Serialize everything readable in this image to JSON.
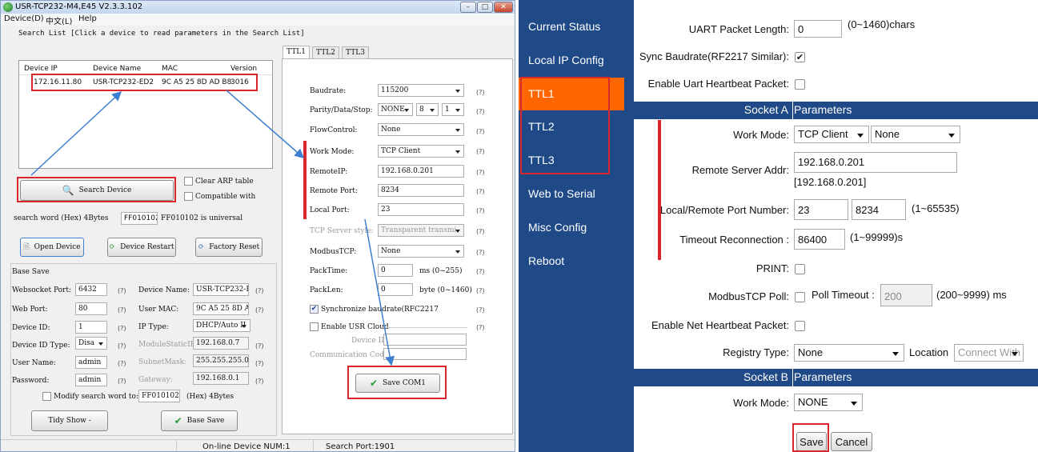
{
  "app": {
    "title": "USR-TCP232-M4,E45 V2.3.3.102",
    "menu": [
      "Device(D)",
      "中文(L)",
      "Help"
    ]
  },
  "search": {
    "hint": "Search List [Click a device to read parameters in the Search List]",
    "columns": [
      "Device IP",
      "Device Name",
      "MAC",
      "Version"
    ],
    "rows": [
      {
        "ip": "172.16.11.80",
        "name": "USR-TCP232-ED2",
        "mac": "9C A5 25 8D AD B8",
        "version": "3016"
      }
    ],
    "search_button": "Search Device",
    "clear_arp": "Clear ARP table",
    "compatible": "Compatible with",
    "word_label": "search word (Hex) 4Bytes",
    "word_value": "FF010102",
    "word_note": "FF010102 is universal"
  },
  "actions": {
    "open": "Open Device",
    "restart": "Device Restart",
    "reset": "Factory Reset"
  },
  "base": {
    "title": "Base Save",
    "websocket_label": "Websocket Port:",
    "websocket_value": "6432",
    "web_label": "Web Port:",
    "web_value": "80",
    "devid_label": "Device ID:",
    "devid_value": "1",
    "devidtype_label": "Device ID Type:",
    "devidtype_value": "Disa",
    "user_label": "User Name:",
    "user_value": "admin",
    "pass_label": "Password:",
    "pass_value": "admin",
    "devname_label": "Device Name:",
    "devname_value": "USR-TCP232-ED2",
    "mac_label": "User MAC:",
    "mac_value": "9C A5 25 8D AD",
    "ip_label": "IP    Type:",
    "ip_value": "DHCP/Auto II",
    "static_label": "ModuleStaticIP",
    "static_value": "192.168.0.7",
    "mask_label": "SubnetMask:",
    "mask_value": "255.255.255.0",
    "gw_label": "Gateway:",
    "gw_value": "192.168.0.1",
    "q": "(?)",
    "modify_label": "Modify search word to:",
    "modify_value": "FF010102",
    "modify_note": "(Hex) 4Bytes",
    "tidy": "Tidy Show  -",
    "save": "Base Save"
  },
  "ttl": {
    "tabs": [
      "TTL1",
      "TTL2",
      "TTL3"
    ],
    "rows": [
      {
        "label": "Baudrate:",
        "value": "115200"
      },
      {
        "label": "Parity/Data/Stop:",
        "v1": "NONE",
        "v2": "8",
        "v3": "1"
      },
      {
        "label": "FlowControl:",
        "value": "None"
      },
      {
        "label": "Work Mode:",
        "value": "TCP Client"
      },
      {
        "label": "RemoteIP:",
        "value": "192.168.0.201"
      },
      {
        "label": "Remote Port:",
        "value": "8234"
      },
      {
        "label": "Local Port:",
        "value": "23"
      },
      {
        "label": "TCP Server style:",
        "value": "Transparent transmi"
      },
      {
        "label": "ModbusTCP:",
        "value": "None"
      },
      {
        "label": "PackTime:",
        "value": "0",
        "unit": "ms (0~255)"
      },
      {
        "label": "PackLen:",
        "value": "0",
        "unit": "byte (0~1460)"
      }
    ],
    "sync": "Synchronize baudrate(RFC2217",
    "cloud": "Enable USR Cloud",
    "devid": "Device ID",
    "commcode": "Communication Code",
    "q": "(?)",
    "save": "Save COM1"
  },
  "status": {
    "online": "On-line Device NUM:1",
    "port": "Search Port:1901"
  },
  "web": {
    "nav": [
      "Current Status",
      "Local IP Config",
      "TTL1",
      "TTL2",
      "TTL3",
      "Web to Serial",
      "Misc Config",
      "Reboot"
    ],
    "uart_len_label": "UART Packet Length:",
    "uart_len_value": "0",
    "uart_len_range": "(0~1460)chars",
    "sync_label": "Sync Baudrate(RF2217 Similar):",
    "uart_hb_label": "Enable Uart Heartbeat Packet:",
    "sockA_1": "Socket A",
    "sockA_2": "Parameters",
    "work_label": "Work Mode:",
    "work_value": "TCP Client",
    "work_value2": "None",
    "remote_label": "Remote Server Addr:",
    "remote_value": "192.168.0.201",
    "remote_echo": "[192.168.0.201]",
    "port_label": "Local/Remote Port Number:",
    "port_local": "23",
    "port_remote": "8234",
    "port_range": "(1~65535)",
    "timeout_label": "Timeout Reconnection :",
    "timeout_value": "86400",
    "timeout_range": "(1~99999)s",
    "print_label": "PRINT:",
    "modbus_label": "ModbusTCP Poll:",
    "poll_label": "Poll Timeout :",
    "poll_value": "200",
    "poll_range": "(200~9999) ms",
    "net_hb_label": "Enable Net Heartbeat Packet:",
    "registry_label": "Registry Type:",
    "registry_value": "None",
    "location_label": "Location",
    "location_value": "Connect With",
    "sockB_1": "Socket B",
    "sockB_2": "Parameters",
    "workB_label": "Work Mode:",
    "workB_value": "NONE",
    "save": "Save",
    "cancel": "Cancel"
  },
  "colors": {
    "nav": "#1f4a87",
    "active": "#ff6600",
    "highlight": "#d9282d",
    "arrow": "#3f7fd0"
  }
}
